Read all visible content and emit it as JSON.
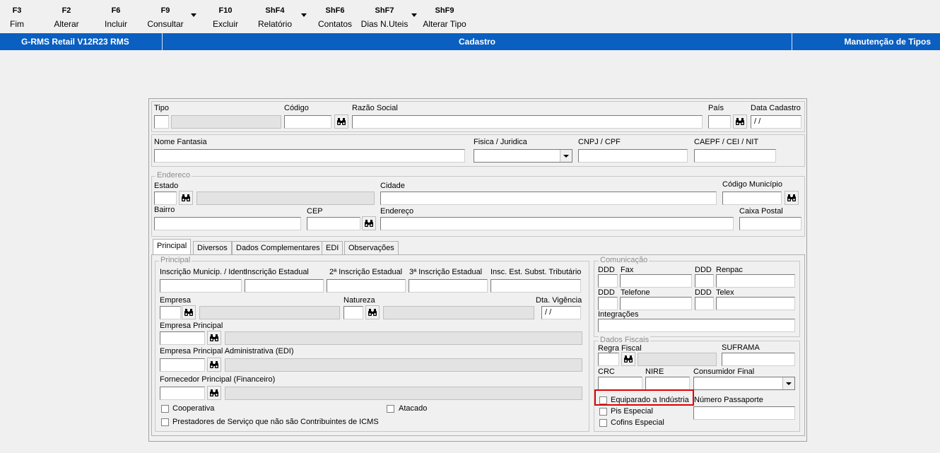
{
  "toolbar": [
    {
      "key": "F3",
      "label": "Fim"
    },
    {
      "key": "F2",
      "label": "Alterar"
    },
    {
      "key": "F6",
      "label": "Incluir"
    },
    {
      "key": "F9",
      "label": "Consultar"
    },
    {
      "key": "F10",
      "label": "Excluir"
    },
    {
      "key": "ShF4",
      "label": "Relatório"
    },
    {
      "key": "ShF6",
      "label": "Contatos"
    },
    {
      "key": "ShF7",
      "label": "Dias N.Uteis"
    },
    {
      "key": "ShF9",
      "label": "Alterar Tipo"
    }
  ],
  "header": {
    "app": "G-RMS Retail V12R23 RMS",
    "module": "Cadastro",
    "screen": "Manutenção de Tipos"
  },
  "top": {
    "tipo": "Tipo",
    "codigo": "Código",
    "razao": "Razão Social",
    "pais": "País",
    "data_cadastro": "Data Cadastro",
    "data_cadastro_value": " / /",
    "nome_fantasia": "Nome Fantasia",
    "fisica_juridica": "Fisica / Juridica",
    "cnpj": "CNPJ / CPF",
    "caepf": "CAEPF / CEI / NIT"
  },
  "endereco": {
    "group": "Endereco",
    "estado": "Estado",
    "cidade": "Cidade",
    "cod_municipio": "Código Município",
    "bairro": "Bairro",
    "cep": "CEP",
    "endereco": "Endereço",
    "caixa_postal": "Caixa Postal"
  },
  "tabs": [
    "Principal",
    "Diversos",
    "Dados Complementares",
    "EDI",
    "Observações"
  ],
  "principal": {
    "group": "Principal",
    "insc_munic": "Inscrição Municip. / Ident",
    "insc_est": "Inscrição Estadual",
    "insc_est2": "2ª Inscrição Estadual",
    "insc_est3": "3ª Inscrição Estadual",
    "insc_subst": "Insc. Est. Subst. Tributário",
    "empresa": "Empresa",
    "natureza": "Natureza",
    "dta_vigencia": "Dta. Vigência",
    "dta_vigencia_value": " / /",
    "empresa_principal": "Empresa Principal",
    "empresa_adm": "Empresa Principal Administrativa (EDI)",
    "fornecedor": "Fornecedor Principal (Financeiro)",
    "cooperativa": "Cooperativa",
    "atacado": "Atacado",
    "prestadores": "Prestadores de Serviço que não são Contribuintes de ICMS"
  },
  "comunicacao": {
    "group": "Comunicação",
    "ddd": "DDD",
    "fax": "Fax",
    "renpac": "Renpac",
    "telefone": "Telefone",
    "telex": "Telex",
    "integracoes": "Integrações"
  },
  "fiscais": {
    "group": "Dados Fiscais",
    "regra": "Regra Fiscal",
    "suframa": "SUFRAMA",
    "crc": "CRC",
    "nire": "NIRE",
    "consumidor": "Consumidor Final",
    "equiparado": "Equiparado a Indústria",
    "passaporte": "Número Passaporte",
    "pis": "Pis Especial",
    "cofins": "Cofins Especial"
  }
}
